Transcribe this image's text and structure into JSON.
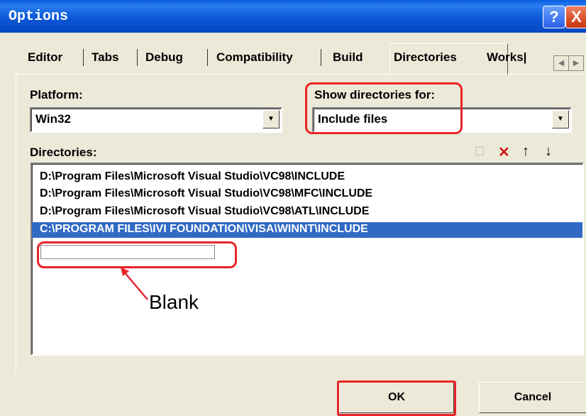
{
  "window": {
    "title": "Options",
    "help_label": "?",
    "close_label": "X"
  },
  "tabs": [
    {
      "label": "Editor"
    },
    {
      "label": "Tabs"
    },
    {
      "label": "Debug"
    },
    {
      "label": "Compatibility"
    },
    {
      "label": "Build"
    },
    {
      "label": "Directories",
      "active": true
    },
    {
      "label": "Works|"
    }
  ],
  "tab_scroll": {
    "left": "◀",
    "right": "▶"
  },
  "platform": {
    "label": "Platform:",
    "value": "Win32"
  },
  "show_dirs": {
    "label": "Show directories for:",
    "value": "Include files"
  },
  "directories": {
    "label": "Directories:",
    "items": [
      "D:\\Program Files\\Microsoft Visual Studio\\VC98\\INCLUDE",
      "D:\\Program Files\\Microsoft Visual Studio\\VC98\\MFC\\INCLUDE",
      "D:\\Program Files\\Microsoft Visual Studio\\VC98\\ATL\\INCLUDE",
      "C:\\PROGRAM FILES\\IVI FOUNDATION\\VISA\\WINNT\\INCLUDE"
    ],
    "selected_index": 3,
    "toolbar_icons": [
      "new-folder-icon",
      "delete-icon",
      "move-up-icon",
      "move-down-icon"
    ]
  },
  "annotation": {
    "text": "Blank"
  },
  "buttons": {
    "ok": "OK",
    "cancel": "Cancel"
  },
  "colors": {
    "highlight": "#e8252a",
    "selection": "#316ac5",
    "titlebar": "#0b58d8"
  }
}
